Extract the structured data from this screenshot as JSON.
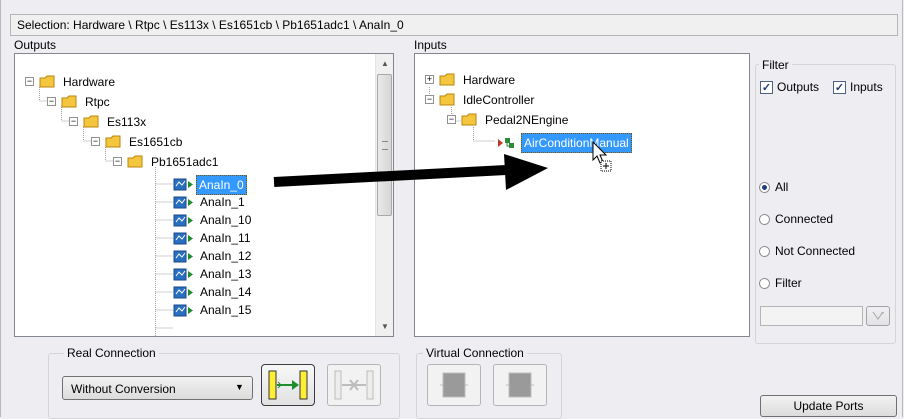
{
  "selection_text": "Selection: Hardware \\ Rtpc \\ Es113x \\ Es1651cb \\ Pb1651adc1 \\ AnaIn_0",
  "outputs": {
    "label": "Outputs",
    "tree": [
      {
        "label": "Hardware"
      },
      {
        "label": "Rtpc"
      },
      {
        "label": "Es113x"
      },
      {
        "label": "Es1651cb"
      },
      {
        "label": "Pb1651adc1"
      },
      {
        "label": "AnaIn_0"
      },
      {
        "label": "AnaIn_1"
      },
      {
        "label": "AnaIn_10"
      },
      {
        "label": "AnaIn_11"
      },
      {
        "label": "AnaIn_12"
      },
      {
        "label": "AnaIn_13"
      },
      {
        "label": "AnaIn_14"
      },
      {
        "label": "AnaIn_15"
      }
    ]
  },
  "inputs": {
    "label": "Inputs",
    "tree": [
      {
        "label": "Hardware"
      },
      {
        "label": "IdleController"
      },
      {
        "label": "Pedal2NEngine"
      },
      {
        "label": "AirConditionManual"
      }
    ]
  },
  "filter": {
    "title": "Filter",
    "outputs_label": "Outputs",
    "inputs_label": "Inputs",
    "outputs_checked": true,
    "inputs_checked": true,
    "radios": [
      {
        "label": "All",
        "selected": true
      },
      {
        "label": "Connected",
        "selected": false
      },
      {
        "label": "Not Connected",
        "selected": false
      },
      {
        "label": "Filter",
        "selected": false
      }
    ],
    "filter_text": ""
  },
  "real_connection": {
    "title": "Real Connection",
    "conversion_value": "Without Conversion"
  },
  "virtual_connection": {
    "title": "Virtual Connection"
  },
  "update_ports_label": "Update Ports",
  "colors": {
    "selection_highlight": "#3399ff",
    "folder": "#f3c63d",
    "port_icon": "#2a6fbf",
    "connect_button": "#ffee33"
  }
}
